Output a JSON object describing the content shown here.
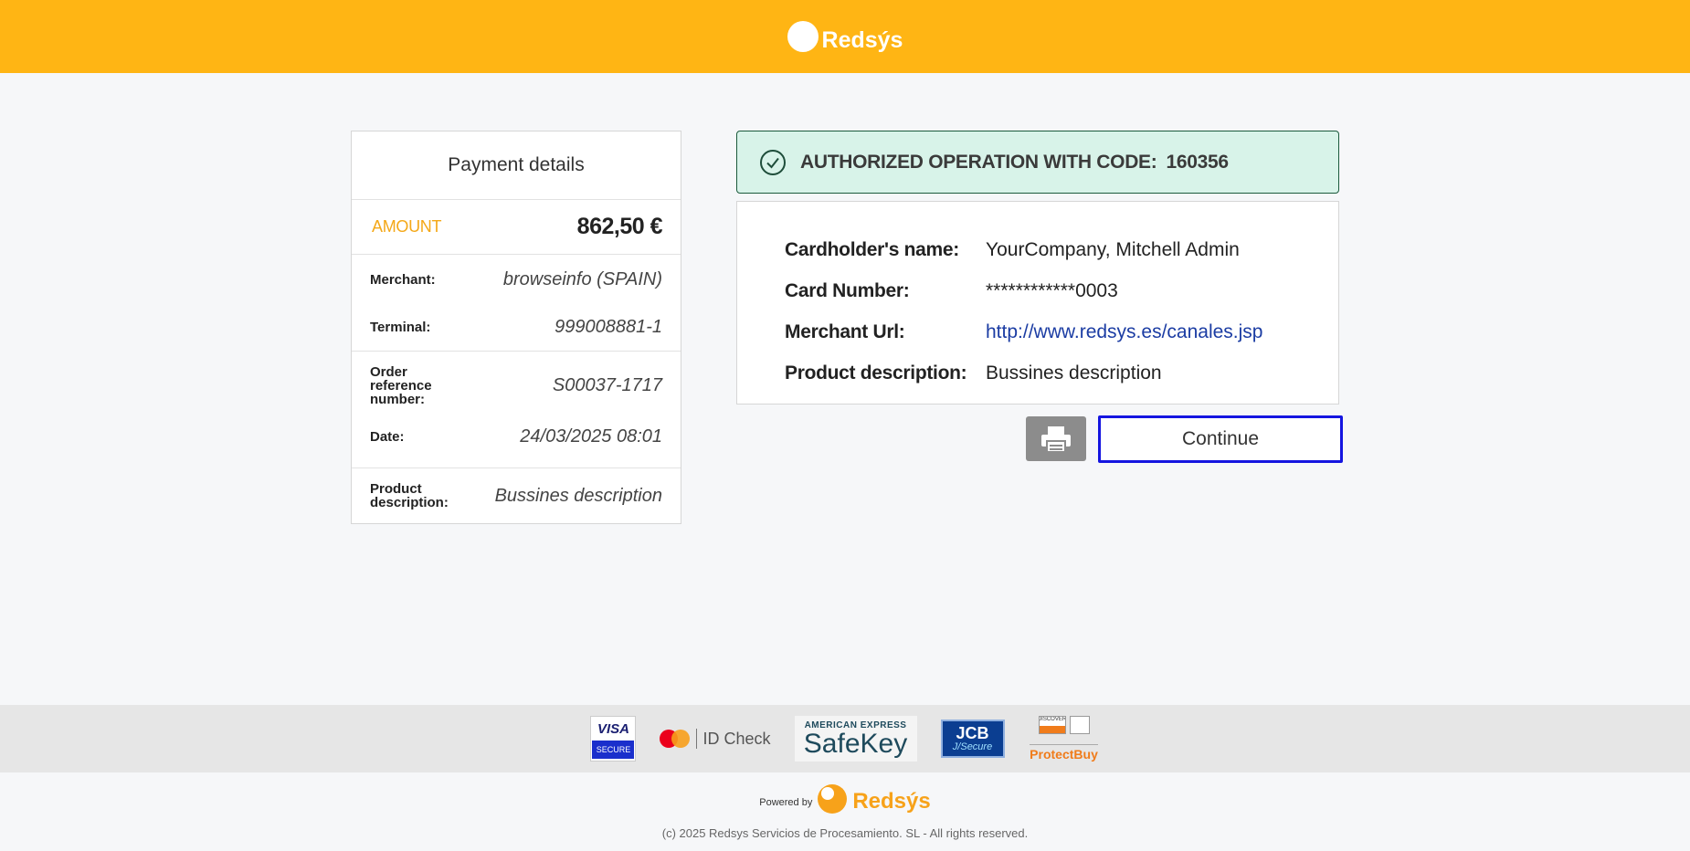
{
  "header": {
    "brand": "Redsýs",
    "color": "#ffb514"
  },
  "details": {
    "title": "Payment details",
    "amount_label": "AMOUNT",
    "amount_value": "862,50  €",
    "merchant_label": "Merchant:",
    "merchant_value": "browseinfo (SPAIN)",
    "terminal_label": "Terminal:",
    "terminal_value": "999008881-1",
    "order_label": "Order reference number:",
    "order_value": "S00037-1717",
    "date_label": "Date:",
    "date_value": "24/03/2025   08:01",
    "product_label": "Product description:",
    "product_value": "Bussines description"
  },
  "auth": {
    "message": "AUTHORIZED OPERATION WITH CODE:",
    "code": "160356",
    "color": "#d8f3e9"
  },
  "info": {
    "rows": [
      {
        "label": "Cardholder's name:",
        "value": "YourCompany, Mitchell Admin"
      },
      {
        "label": "Card Number:",
        "value": "************0003"
      },
      {
        "label": "Merchant Url:",
        "value": "http://www.redsys.es/canales.jsp"
      },
      {
        "label": "Product description:",
        "value": "Bussines description"
      }
    ]
  },
  "actions": {
    "print_icon": "printer-icon",
    "continue_label": "Continue"
  },
  "footer": {
    "visa_top": "VISA",
    "visa_bottom": "SECURE",
    "mc_text": "ID Check",
    "amex_top": "AMERICAN EXPRESS",
    "amex_bottom": "SafeKey",
    "jcb_top": "JCB",
    "jcb_bottom": "J/Secure",
    "discover_label": "DISCOVER",
    "protectbuy": "ProtectBuy",
    "powered_label": "Powered by",
    "powered_brand": "Redsýs",
    "copyright": "(c) 2025 Redsys Servicios de Procesamiento. SL - All rights reserved."
  }
}
